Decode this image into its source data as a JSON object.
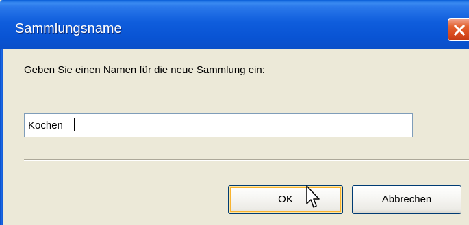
{
  "dialog": {
    "title": "Sammlungsname",
    "prompt": "Geben Sie einen Namen für die neue Sammlung ein:",
    "input_value": "Kochen",
    "ok_label": "OK",
    "cancel_label": "Abbrechen"
  },
  "icons": {
    "close": "close-icon",
    "cursor": "mouse-pointer-icon"
  },
  "colors": {
    "titlebar_blue": "#0954d4",
    "close_red": "#d94a1e",
    "dialog_face": "#ece9d8",
    "input_border": "#7f9db9",
    "button_border": "#003c74",
    "default_button_focus": "#f8b330"
  }
}
